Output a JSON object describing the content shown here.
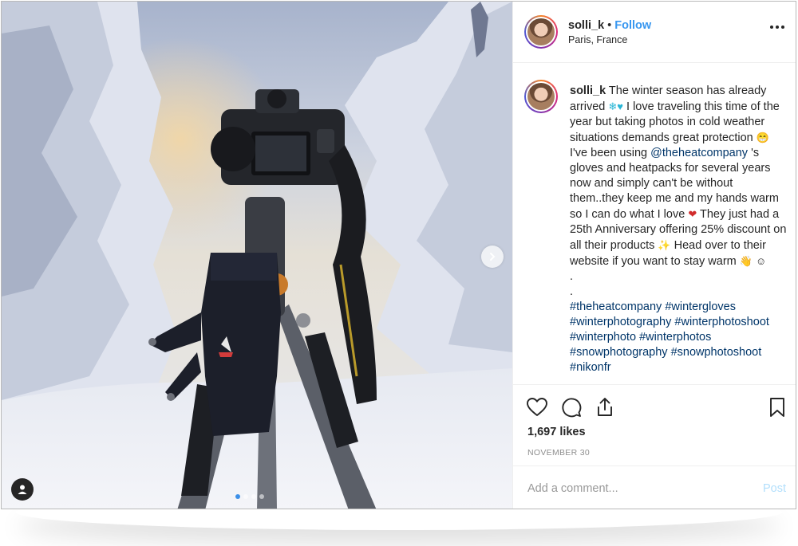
{
  "post": {
    "username": "solli_k",
    "separator": "•",
    "follow_label": "Follow",
    "location": "Paris, France"
  },
  "caption": {
    "username": "solli_k",
    "parts": {
      "p1": "The winter season has already arrived",
      "p2": "I love traveling this time of the year but taking photos in cold weather situations demands great protection",
      "p3": "I've been using",
      "mention": "@theheatcompany",
      "p4": "'s gloves and heatpacks for several years now and simply can't be without them..they keep me and my hands warm so I can do what I love",
      "p5": "They just had a 25th Anniversary offering 25% discount on all their products",
      "p6": "Head over to their website if you want to stay warm",
      "dot1": ".",
      "dot2": "."
    },
    "emojis": {
      "snow_heart": "❄♥",
      "grin": "😁",
      "hearts": "❤",
      "sparkle": "✨",
      "hand": "👋",
      "smile": "☺"
    },
    "hashtags": [
      "#theheatcompany",
      "#wintergloves",
      "#winterphotography",
      "#winterphotoshoot",
      "#winterphoto",
      "#winterphotos",
      "#snowphotography",
      "#snowphotoshoot",
      "#nikonfr"
    ]
  },
  "stats": {
    "likes": "1,697 likes",
    "date": "NOVEMBER 30"
  },
  "comment": {
    "placeholder": "Add a comment...",
    "post_label": "Post"
  },
  "carousel": {
    "slide_count": 4,
    "active_index": 0
  },
  "colors": {
    "follow": "#3897f0",
    "link": "#003569",
    "post_disabled": "#b2dffc",
    "active_dot": "#3b8fe8"
  },
  "icons": [
    "heart-icon",
    "comment-icon",
    "share-icon",
    "bookmark-icon",
    "more-icon",
    "chevron-right-icon",
    "user-tag-icon"
  ]
}
